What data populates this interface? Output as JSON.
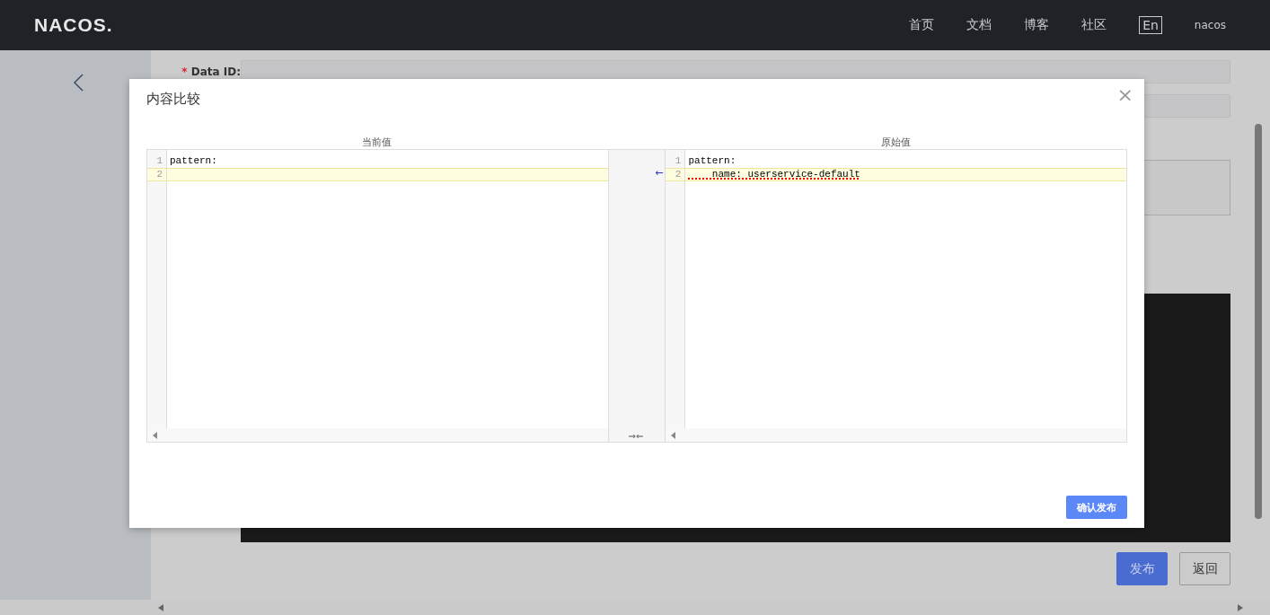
{
  "header": {
    "logo": "NACOS.",
    "nav": [
      {
        "label": "首页"
      },
      {
        "label": "文档"
      },
      {
        "label": "博客"
      },
      {
        "label": "社区"
      }
    ],
    "language": "En",
    "user": "nacos"
  },
  "form": {
    "data_id_label": "Data ID:",
    "required_mark": "*"
  },
  "actions": [
    {
      "label": "发布",
      "kind": "primary"
    },
    {
      "label": "返回",
      "kind": "secondary"
    }
  ],
  "dialog": {
    "title": "内容比较",
    "close": "×",
    "panes": [
      {
        "title": "当前值",
        "lines": [
          {
            "number": "1",
            "text": "pattern:",
            "changed": false
          },
          {
            "number": "2",
            "changed": true
          }
        ]
      },
      {
        "title": "原始值",
        "lines": [
          {
            "number": "1",
            "text": "pattern:",
            "changed": false
          },
          {
            "number": "2",
            "text": "    name: userservice-default",
            "changed": true,
            "spell_flagged": true
          }
        ]
      }
    ],
    "revert_arrow": "←",
    "merge_marks": "⇒⇐",
    "confirm": "确认发布"
  }
}
